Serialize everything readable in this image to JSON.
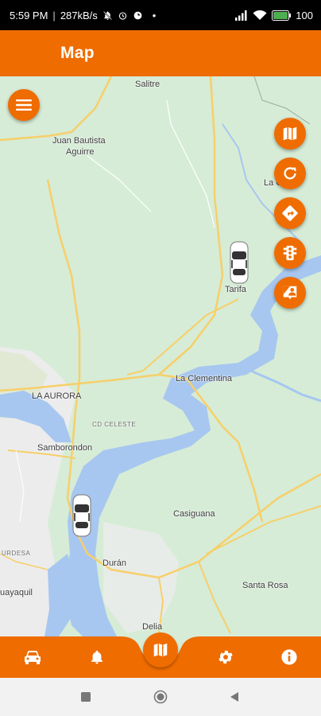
{
  "status_bar": {
    "time": "5:59 PM",
    "speed": "287kB/s",
    "battery": "100"
  },
  "app_bar": {
    "title": "Map"
  },
  "map": {
    "places": [
      {
        "label": "Salitre"
      },
      {
        "label": "Juan Bautista"
      },
      {
        "label": "Aguirre"
      },
      {
        "label": "La Clem"
      },
      {
        "label": "Tarifa"
      },
      {
        "label": "La Clementina"
      },
      {
        "label": "LA AURORA"
      },
      {
        "label": "CD CELESTE"
      },
      {
        "label": "Samborondon"
      },
      {
        "label": "Casiguana"
      },
      {
        "label": "URDESA"
      },
      {
        "label": "Durán"
      },
      {
        "label": "uayaquil"
      },
      {
        "label": "Santa Rosa"
      },
      {
        "label": "Delia"
      }
    ]
  },
  "colors": {
    "accent": "#ef6c00",
    "map_land": "#d6ecd6",
    "map_water": "#a7c7f0",
    "map_road": "#f7cf6a",
    "map_urban": "#ececec"
  },
  "icons": {
    "menu": "menu-icon",
    "map_type": "map-icon",
    "refresh": "refresh-icon",
    "directions": "directions-icon",
    "traffic": "traffic-light-icon",
    "person_pin": "person-pin-icon",
    "car": "car-icon",
    "bell": "bell-icon",
    "gear": "gear-icon",
    "info": "info-icon"
  }
}
